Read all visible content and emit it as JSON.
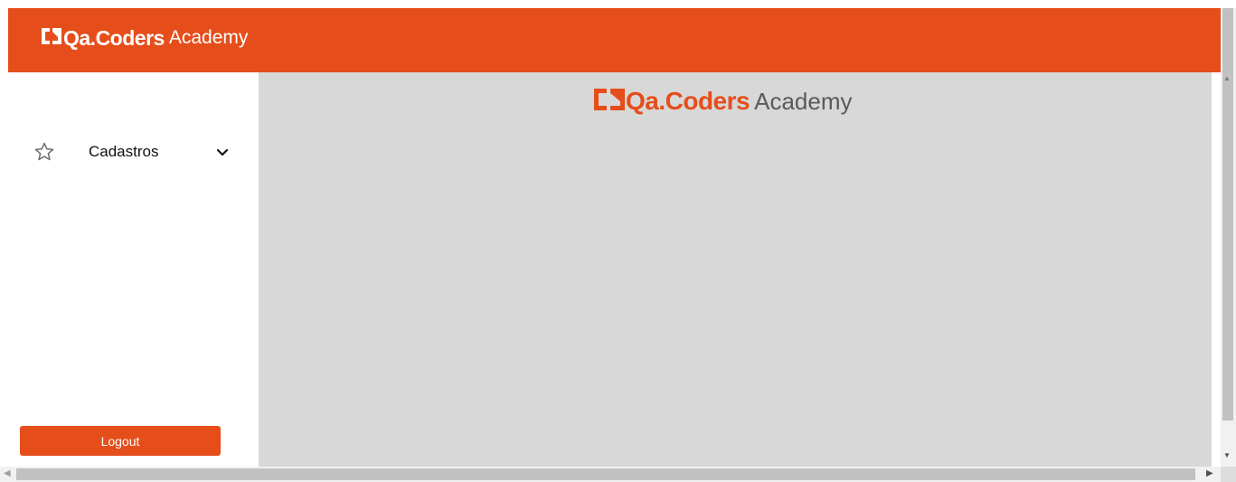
{
  "brand": {
    "name": "Qa.Coders",
    "suffix": "Academy"
  },
  "colors": {
    "accent": "#e54e1b",
    "content_bg": "#d8d8d8",
    "sidebar_bg": "#ffffff"
  },
  "sidebar": {
    "items": [
      {
        "label": "Cadastros",
        "icon": "star-icon",
        "expand_icon": "chevron-down-icon"
      }
    ],
    "logout_label": "Logout"
  }
}
